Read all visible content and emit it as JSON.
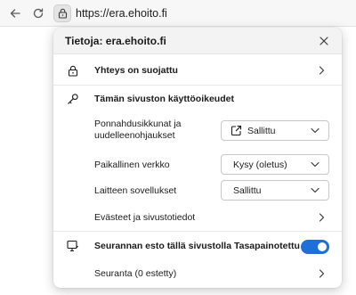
{
  "browser": {
    "url": "https://era.ehoito.fi"
  },
  "popup": {
    "title": "Tietoja: era.ehoito.fi",
    "connection_label": "Yhteys on suojattu",
    "permissions_heading": "Tämän sivuston käyttöoikeudet",
    "permissions": [
      {
        "label_line1": "Ponnahdusikkunat ja",
        "label_line2": "uudelleenohjaukset",
        "value": "Sallittu",
        "icon": "external-link-icon"
      },
      {
        "label_line1": "Paikallinen verkko",
        "label_line2": "",
        "value": "Kysy (oletus)",
        "icon": ""
      },
      {
        "label_line1": "Laitteen sovellukset",
        "label_line2": "",
        "value": "Sallittu",
        "icon": ""
      }
    ],
    "cookies_label": "Evästeet ja sivustotiedot",
    "tracking_label": "Seurannan esto tällä sivustolla Tasapainotettu",
    "tracking_enabled": true,
    "tracking_count_label": "Seuranta (0 estetty)"
  },
  "colors": {
    "toggle_on": "#1f6fd6",
    "header_bg": "#f3f3f3"
  }
}
